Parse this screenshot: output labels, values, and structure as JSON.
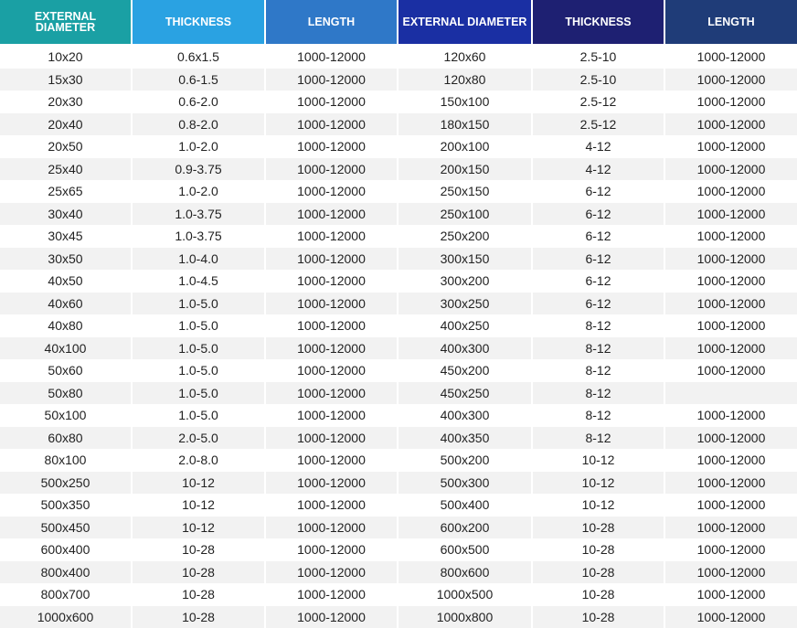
{
  "headers": [
    "EXTERNAL DIAMETER",
    "THICKNESS",
    "LENGTH",
    "EXTERNAL DIAMETER",
    "THICKNESS",
    "LENGTH"
  ],
  "rows": [
    [
      "10x20",
      "0.6x1.5",
      "1000-12000",
      "120x60",
      "2.5-10",
      "1000-12000"
    ],
    [
      "15x30",
      "0.6-1.5",
      "1000-12000",
      "120x80",
      "2.5-10",
      "1000-12000"
    ],
    [
      "20x30",
      "0.6-2.0",
      "1000-12000",
      "150x100",
      "2.5-12",
      "1000-12000"
    ],
    [
      "20x40",
      "0.8-2.0",
      "1000-12000",
      "180x150",
      "2.5-12",
      "1000-12000"
    ],
    [
      "20x50",
      "1.0-2.0",
      "1000-12000",
      "200x100",
      "4-12",
      "1000-12000"
    ],
    [
      "25x40",
      "0.9-3.75",
      "1000-12000",
      "200x150",
      "4-12",
      "1000-12000"
    ],
    [
      "25x65",
      "1.0-2.0",
      "1000-12000",
      "250x150",
      "6-12",
      "1000-12000"
    ],
    [
      "30x40",
      "1.0-3.75",
      "1000-12000",
      "250x100",
      "6-12",
      "1000-12000"
    ],
    [
      "30x45",
      "1.0-3.75",
      "1000-12000",
      "250x200",
      "6-12",
      "1000-12000"
    ],
    [
      "30x50",
      "1.0-4.0",
      "1000-12000",
      "300x150",
      "6-12",
      "1000-12000"
    ],
    [
      "40x50",
      "1.0-4.5",
      "1000-12000",
      "300x200",
      "6-12",
      "1000-12000"
    ],
    [
      "40x60",
      "1.0-5.0",
      "1000-12000",
      "300x250",
      "6-12",
      "1000-12000"
    ],
    [
      "40x80",
      "1.0-5.0",
      "1000-12000",
      "400x250",
      "8-12",
      "1000-12000"
    ],
    [
      "40x100",
      "1.0-5.0",
      "1000-12000",
      "400x300",
      "8-12",
      "1000-12000"
    ],
    [
      "50x60",
      "1.0-5.0",
      "1000-12000",
      "450x200",
      "8-12",
      "1000-12000"
    ],
    [
      "50x80",
      "1.0-5.0",
      "1000-12000",
      "450x250",
      "8-12",
      ""
    ],
    [
      "50x100",
      "1.0-5.0",
      "1000-12000",
      "400x300",
      "8-12",
      "1000-12000"
    ],
    [
      "60x80",
      "2.0-5.0",
      "1000-12000",
      "400x350",
      "8-12",
      "1000-12000"
    ],
    [
      "80x100",
      "2.0-8.0",
      "1000-12000",
      "500x200",
      "10-12",
      "1000-12000"
    ],
    [
      "500x250",
      "10-12",
      "1000-12000",
      "500x300",
      "10-12",
      "1000-12000"
    ],
    [
      "500x350",
      "10-12",
      "1000-12000",
      "500x400",
      "10-12",
      "1000-12000"
    ],
    [
      "500x450",
      "10-12",
      "1000-12000",
      "600x200",
      "10-28",
      "1000-12000"
    ],
    [
      "600x400",
      "10-28",
      "1000-12000",
      "600x500",
      "10-28",
      "1000-12000"
    ],
    [
      "800x400",
      "10-28",
      "1000-12000",
      "800x600",
      "10-28",
      "1000-12000"
    ],
    [
      "800x700",
      "10-28",
      "1000-12000",
      "1000x500",
      "10-28",
      "1000-12000"
    ],
    [
      "1000x600",
      "10-28",
      "1000-12000",
      "1000x800",
      "10-28",
      "1000-12000"
    ]
  ],
  "colors": {
    "header_1": "#1aa0a4",
    "header_2": "#2aa2e2",
    "header_3": "#2f78c8",
    "header_4": "#1a2fa3",
    "header_5": "#1e2072",
    "header_6": "#1f3c78",
    "stripe": "#f2f2f2"
  }
}
